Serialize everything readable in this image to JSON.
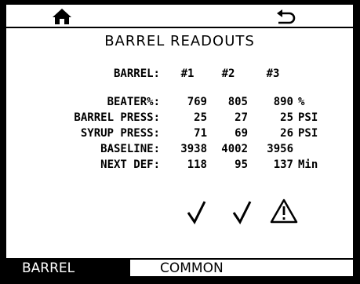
{
  "title": "BARREL READOUTS",
  "header": {
    "label": "BARREL:",
    "c1": "#1",
    "c2": "#2",
    "c3": "#3"
  },
  "rows": [
    {
      "label": "BEATER%:",
      "v1": "769",
      "v2": "805",
      "v3": "890",
      "unit": "%"
    },
    {
      "label": "BARREL PRESS:",
      "v1": "25",
      "v2": "27",
      "v3": "25",
      "unit": "PSI"
    },
    {
      "label": "SYRUP PRESS:",
      "v1": "71",
      "v2": "69",
      "v3": "26",
      "unit": "PSI"
    },
    {
      "label": "BASELINE:",
      "v1": "3938",
      "v2": "4002",
      "v3": "3956",
      "unit": ""
    },
    {
      "label": "NEXT DEF:",
      "v1": "118",
      "v2": "95",
      "v3": "137",
      "unit": "Min"
    }
  ],
  "status_icons": [
    "check-icon",
    "check-icon",
    "warning-icon"
  ],
  "tabs": [
    {
      "label": "BARREL",
      "active": true
    },
    {
      "label": "COMMON",
      "active": false
    }
  ],
  "icons": {
    "home": "home-icon",
    "back": "back-icon"
  }
}
